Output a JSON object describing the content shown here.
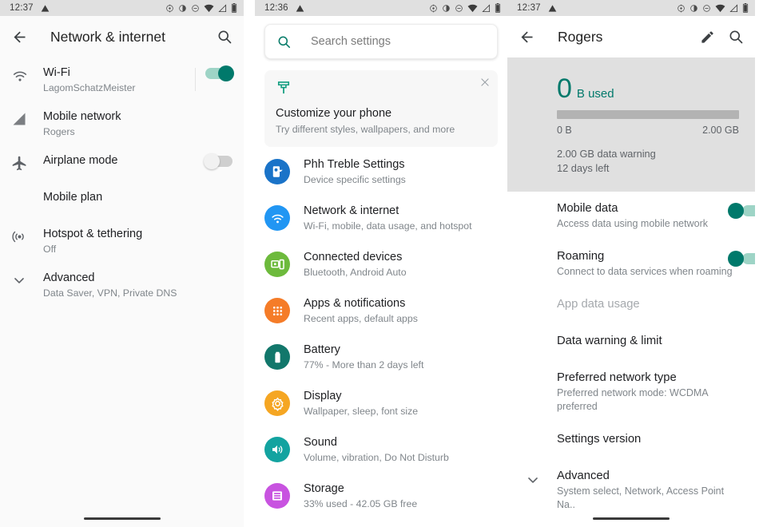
{
  "panel1": {
    "statusbar": {
      "clock": "12:37",
      "icons": [
        "warning-triangle-icon",
        "location-icon",
        "contrast-icon",
        "dnd-icon",
        "wifi-icon",
        "signal-icon",
        "battery-icon"
      ]
    },
    "appbar": {
      "back": "back-arrow-icon",
      "title": "Network & internet",
      "search": "search-icon"
    },
    "rows": [
      {
        "icon": "wifi-icon",
        "title": "Wi-Fi",
        "subtitle": "LagomSchatzMeister",
        "toggle": "on"
      },
      {
        "icon": "signal-icon",
        "title": "Mobile network",
        "subtitle": "Rogers",
        "toggle": null
      },
      {
        "icon": "airplane-icon",
        "title": "Airplane mode",
        "subtitle": "",
        "toggle": "off"
      },
      {
        "icon": "",
        "title": "Mobile plan",
        "subtitle": "",
        "toggle": null
      },
      {
        "icon": "hotspot-icon",
        "title": "Hotspot & tethering",
        "subtitle": "Off",
        "toggle": null
      },
      {
        "icon": "chevron-down-icon",
        "title": "Advanced",
        "subtitle": "Data Saver, VPN, Private DNS",
        "toggle": null
      }
    ]
  },
  "panel2": {
    "statusbar": {
      "clock": "12:36"
    },
    "search": {
      "placeholder": "Search settings",
      "icon": "search-icon"
    },
    "promo": {
      "icon": "paintbrush-icon",
      "title": "Customize your phone",
      "subtitle": "Try different styles, wallpapers, and more",
      "close": "close-icon"
    },
    "items": [
      {
        "title": "Phh Treble Settings",
        "subtitle": "Device specific settings",
        "icon": "treble-icon",
        "color": "#1a73c8"
      },
      {
        "title": "Network & internet",
        "subtitle": "Wi-Fi, mobile, data usage, and hotspot",
        "icon": "wifi-icon",
        "color": "#2196f3"
      },
      {
        "title": "Connected devices",
        "subtitle": "Bluetooth, Android Auto",
        "icon": "devices-icon",
        "color": "#6dba3c"
      },
      {
        "title": "Apps & notifications",
        "subtitle": "Recent apps, default apps",
        "icon": "apps-grid-icon",
        "color": "#f57c28"
      },
      {
        "title": "Battery",
        "subtitle": "77% - More than 2 days left",
        "icon": "battery-icon",
        "color": "#12776b"
      },
      {
        "title": "Display",
        "subtitle": "Wallpaper, sleep, font size",
        "icon": "brightness-icon",
        "color": "#f5a623"
      },
      {
        "title": "Sound",
        "subtitle": "Volume, vibration, Do Not Disturb",
        "icon": "volume-icon",
        "color": "#13a3a0"
      },
      {
        "title": "Storage",
        "subtitle": "33% used - 42.05 GB free",
        "icon": "storage-icon",
        "color": "#c853e0"
      }
    ]
  },
  "panel3": {
    "statusbar": {
      "clock": "12:37"
    },
    "appbar": {
      "back": "back-arrow-icon",
      "title": "Rogers",
      "edit": "pencil-icon",
      "search": "search-icon"
    },
    "usage": {
      "amount": "0",
      "unit": "B used",
      "bar_min": "0 B",
      "bar_max": "2.00 GB",
      "warning": "2.00 GB data warning",
      "days_left": "12 days left",
      "progress_percent": 0,
      "accent_color": "#00796b"
    },
    "rows": [
      {
        "title": "Mobile data",
        "subtitle": "Access data using mobile network",
        "toggle": "on",
        "dim": false,
        "chevron": false
      },
      {
        "title": "Roaming",
        "subtitle": "Connect to data services when roaming",
        "toggle": "on",
        "dim": false,
        "chevron": false
      },
      {
        "title": "App data usage",
        "subtitle": "",
        "toggle": null,
        "dim": true,
        "chevron": false
      },
      {
        "title": "Data warning & limit",
        "subtitle": "",
        "toggle": null,
        "dim": false,
        "chevron": false
      },
      {
        "title": "Preferred network type",
        "subtitle": "Preferred network mode: WCDMA preferred",
        "toggle": null,
        "dim": false,
        "chevron": false
      },
      {
        "title": "Settings version",
        "subtitle": "",
        "toggle": null,
        "dim": false,
        "chevron": false
      },
      {
        "title": "Advanced",
        "subtitle": "System select, Network, Access Point Na..",
        "toggle": null,
        "dim": false,
        "chevron": true
      }
    ]
  }
}
